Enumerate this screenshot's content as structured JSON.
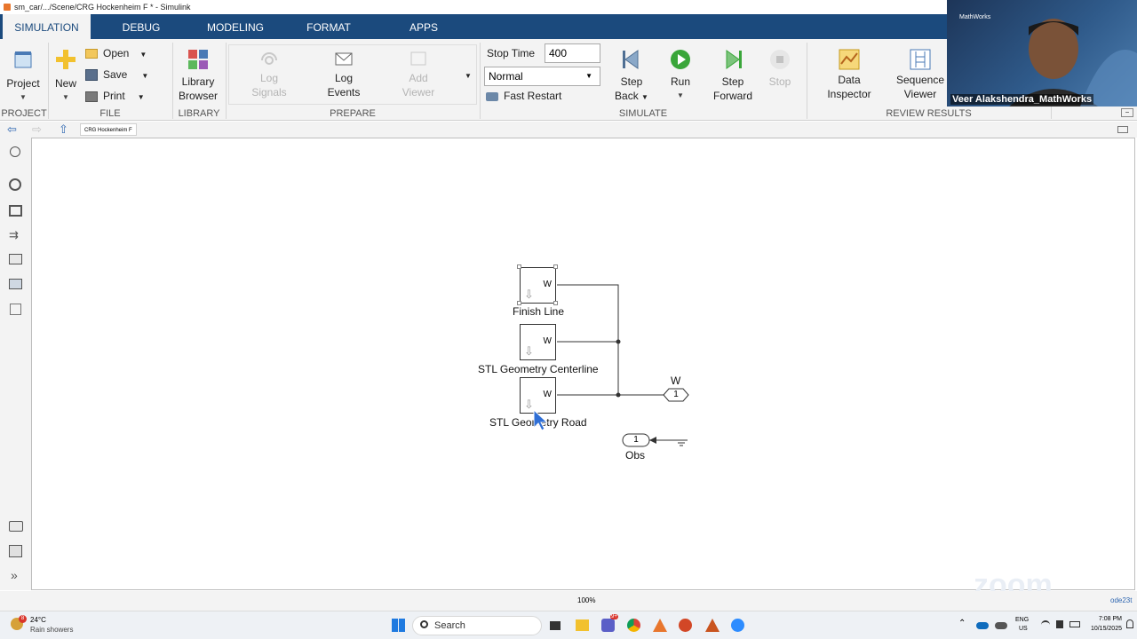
{
  "window": {
    "title": "sm_car/.../Scene/CRG Hockenheim F * - Simulink"
  },
  "tabs": [
    {
      "label": "SIMULATION",
      "active": true
    },
    {
      "label": "DEBUG"
    },
    {
      "label": "MODELING"
    },
    {
      "label": "FORMAT"
    },
    {
      "label": "APPS"
    }
  ],
  "ribbon": {
    "project": {
      "project": "Project",
      "new": "New",
      "open": "Open",
      "save": "Save",
      "print": "Print",
      "section": "PROJECT",
      "file_section": "FILE"
    },
    "library": {
      "line1": "Library",
      "line2": "Browser",
      "section": "LIBRARY"
    },
    "prepare": {
      "log_signals": [
        "Log",
        "Signals"
      ],
      "log_events": [
        "Log",
        "Events"
      ],
      "add_viewer": [
        "Add",
        "Viewer"
      ],
      "section": "PREPARE"
    },
    "simulate": {
      "stop_time_label": "Stop Time",
      "stop_time_value": "400",
      "mode": "Normal",
      "fast_restart": "Fast Restart",
      "step_back": [
        "Step",
        "Back"
      ],
      "run": "Run",
      "step_forward": [
        "Step",
        "Forward"
      ],
      "stop": "Stop",
      "section": "SIMULATE"
    },
    "review": {
      "data_inspector": [
        "Data",
        "Inspector"
      ],
      "sequence_viewer": [
        "Sequence",
        "Viewer"
      ],
      "section": "REVIEW RESULTS"
    }
  },
  "breadcrumb": "CRG Hockenheim F",
  "video": {
    "name": "Veer Alakshendra_MathWorks",
    "logo": "MathWorks"
  },
  "diagram": {
    "blocks": [
      {
        "label": "Finish Line",
        "port": "W"
      },
      {
        "label": "STL Geometry Centerline",
        "port": "W"
      },
      {
        "label": "STL Geometry Road",
        "port": "W"
      }
    ],
    "outport": {
      "name": "W",
      "number": "1"
    },
    "inport": {
      "name": "Obs",
      "number": "1"
    }
  },
  "status": {
    "zoom": "100%",
    "solver": "ode23t"
  },
  "taskbar": {
    "weather_temp": "24°C",
    "weather_desc": "Rain showers",
    "weather_badge": "8",
    "search": "Search",
    "lang1": "ENG",
    "lang2": "US",
    "time": "7:08 PM",
    "date": "10/15/2025",
    "zoom_watermark": "zoom",
    "teams_badge": "9+"
  },
  "colors": {
    "tab_bar": "#1b4a7d",
    "ribbon_bg": "#f3f3f3",
    "run_green": "#3aa63a",
    "accent": "#0f6cbd"
  }
}
